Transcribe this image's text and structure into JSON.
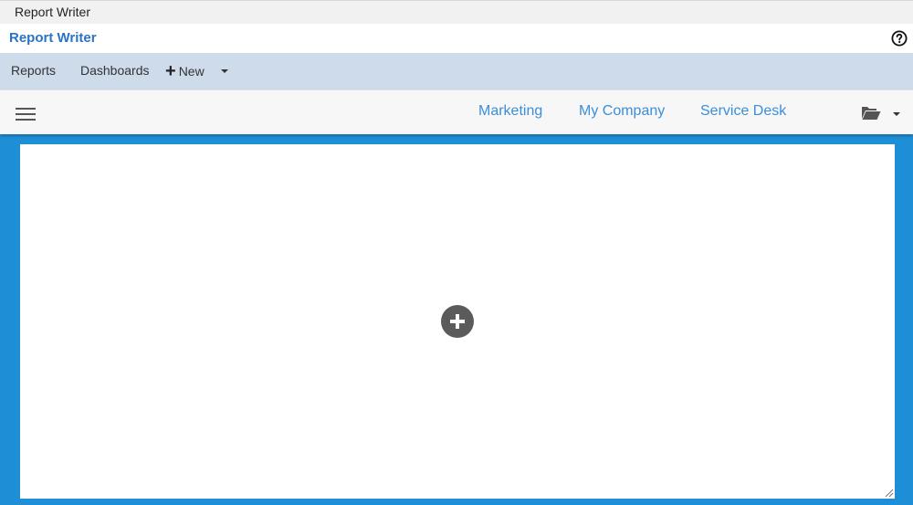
{
  "window": {
    "title": "Report Writer"
  },
  "header": {
    "app_title": "Report Writer",
    "help_icon": "help-circle-icon"
  },
  "menu": {
    "reports_label": "Reports",
    "dashboards_label": "Dashboards",
    "new_label": "New",
    "new_icon": "plus-icon"
  },
  "toolbar": {
    "menu_icon": "hamburger-icon",
    "tabs": [
      {
        "label": "Marketing"
      },
      {
        "label": "My Company"
      },
      {
        "label": "Service Desk"
      }
    ],
    "folder_icon": "open-folder-icon"
  },
  "canvas": {
    "add_icon": "add-widget-plus-icon"
  },
  "colors": {
    "accent": "#2a73c5",
    "tab_link": "#3b8ed8",
    "menubar_bg": "#cddbeb",
    "workspace_bg": "#1e8fd6"
  }
}
